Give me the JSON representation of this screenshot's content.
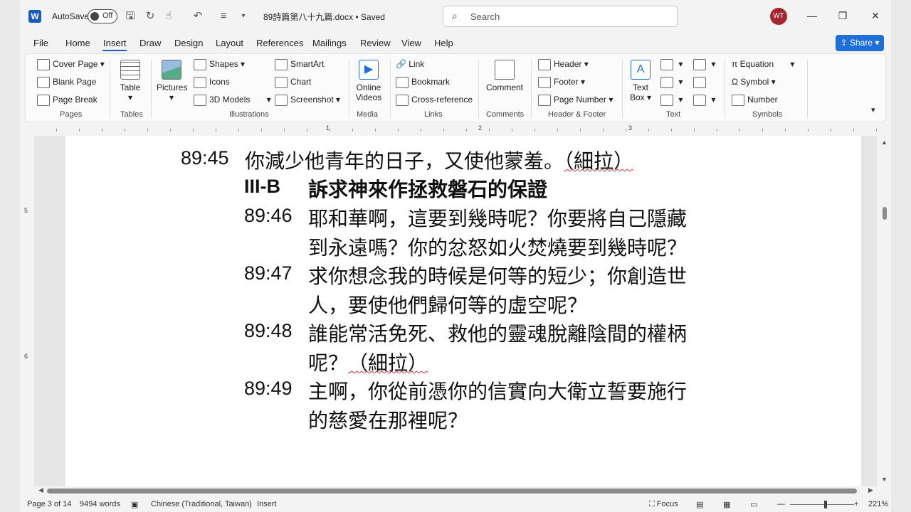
{
  "titlebar": {
    "autosave_label": "AutoSave",
    "autosave_state": "Off",
    "doc_title": "89詩篇第八十九篇.docx • Saved",
    "search_placeholder": "Search",
    "avatar_initials": "WT"
  },
  "menu": {
    "items": [
      "File",
      "Home",
      "Insert",
      "Draw",
      "Design",
      "Layout",
      "References",
      "Mailings",
      "Review",
      "View",
      "Help"
    ],
    "active": "Insert",
    "share_label": "Share"
  },
  "ribbon": {
    "pages": {
      "label": "Pages",
      "items": [
        "Cover Page",
        "Blank Page",
        "Page Break"
      ]
    },
    "tables": {
      "label": "Tables",
      "button": "Table"
    },
    "illustrations": {
      "label": "Illustrations",
      "pictures": "Pictures",
      "items": [
        "Shapes",
        "Icons",
        "3D Models",
        "SmartArt",
        "Chart",
        "Screenshot"
      ]
    },
    "media": {
      "label": "Media",
      "button_line1": "Online",
      "button_line2": "Videos"
    },
    "links": {
      "label": "Links",
      "items": [
        "Link",
        "Bookmark",
        "Cross-reference"
      ]
    },
    "comments": {
      "label": "Comments",
      "button": "Comment"
    },
    "header_footer": {
      "label": "Header & Footer",
      "items": [
        "Header",
        "Footer",
        "Page Number"
      ]
    },
    "text": {
      "label": "Text",
      "textbox_line1": "Text",
      "textbox_line2": "Box"
    },
    "symbols": {
      "label": "Symbols",
      "items": [
        "Equation",
        "Symbol",
        "Number"
      ]
    }
  },
  "ruler": {
    "marks": [
      "1",
      "2",
      "3"
    ],
    "vmarks": [
      "5",
      "6"
    ]
  },
  "document": {
    "lines": [
      {
        "ref": "89:45",
        "text": "你減少他青年的日子，又使他蒙羞。",
        "paren": "（細拉）"
      },
      {
        "heading_ref": "III-B",
        "heading": "訴求神來作拯救磐石的保證"
      },
      {
        "ref": "89:46",
        "text": "耶和華啊，這要到幾時呢？你要將自己隱藏"
      },
      {
        "ref": "",
        "text": "到永遠嗎？你的忿怒如火焚燒要到幾時呢？"
      },
      {
        "ref": "89:47",
        "text": "求你想念我的時候是何等的短少；你創造世"
      },
      {
        "ref": "",
        "text": "人，要使他們歸何等的虛空呢？"
      },
      {
        "ref": "89:48",
        "text": "誰能常活免死、救他的靈魂脫離陰間的權柄"
      },
      {
        "ref": "",
        "text": "呢？",
        "paren": "（細拉）"
      },
      {
        "ref": "89:49",
        "text": "主啊，你從前憑你的信實向大衛立誓要施行"
      },
      {
        "ref": "",
        "text": "的慈愛在那裡呢？"
      }
    ]
  },
  "status": {
    "page": "Page 3 of 14",
    "words": "9494 words",
    "language": "Chinese (Traditional, Taiwan)",
    "mode": "Insert",
    "focus": "Focus",
    "zoom": "221%"
  },
  "colors": {
    "accent": "#185abd",
    "share": "#1e6fd9",
    "avatar": "#a4262c"
  }
}
